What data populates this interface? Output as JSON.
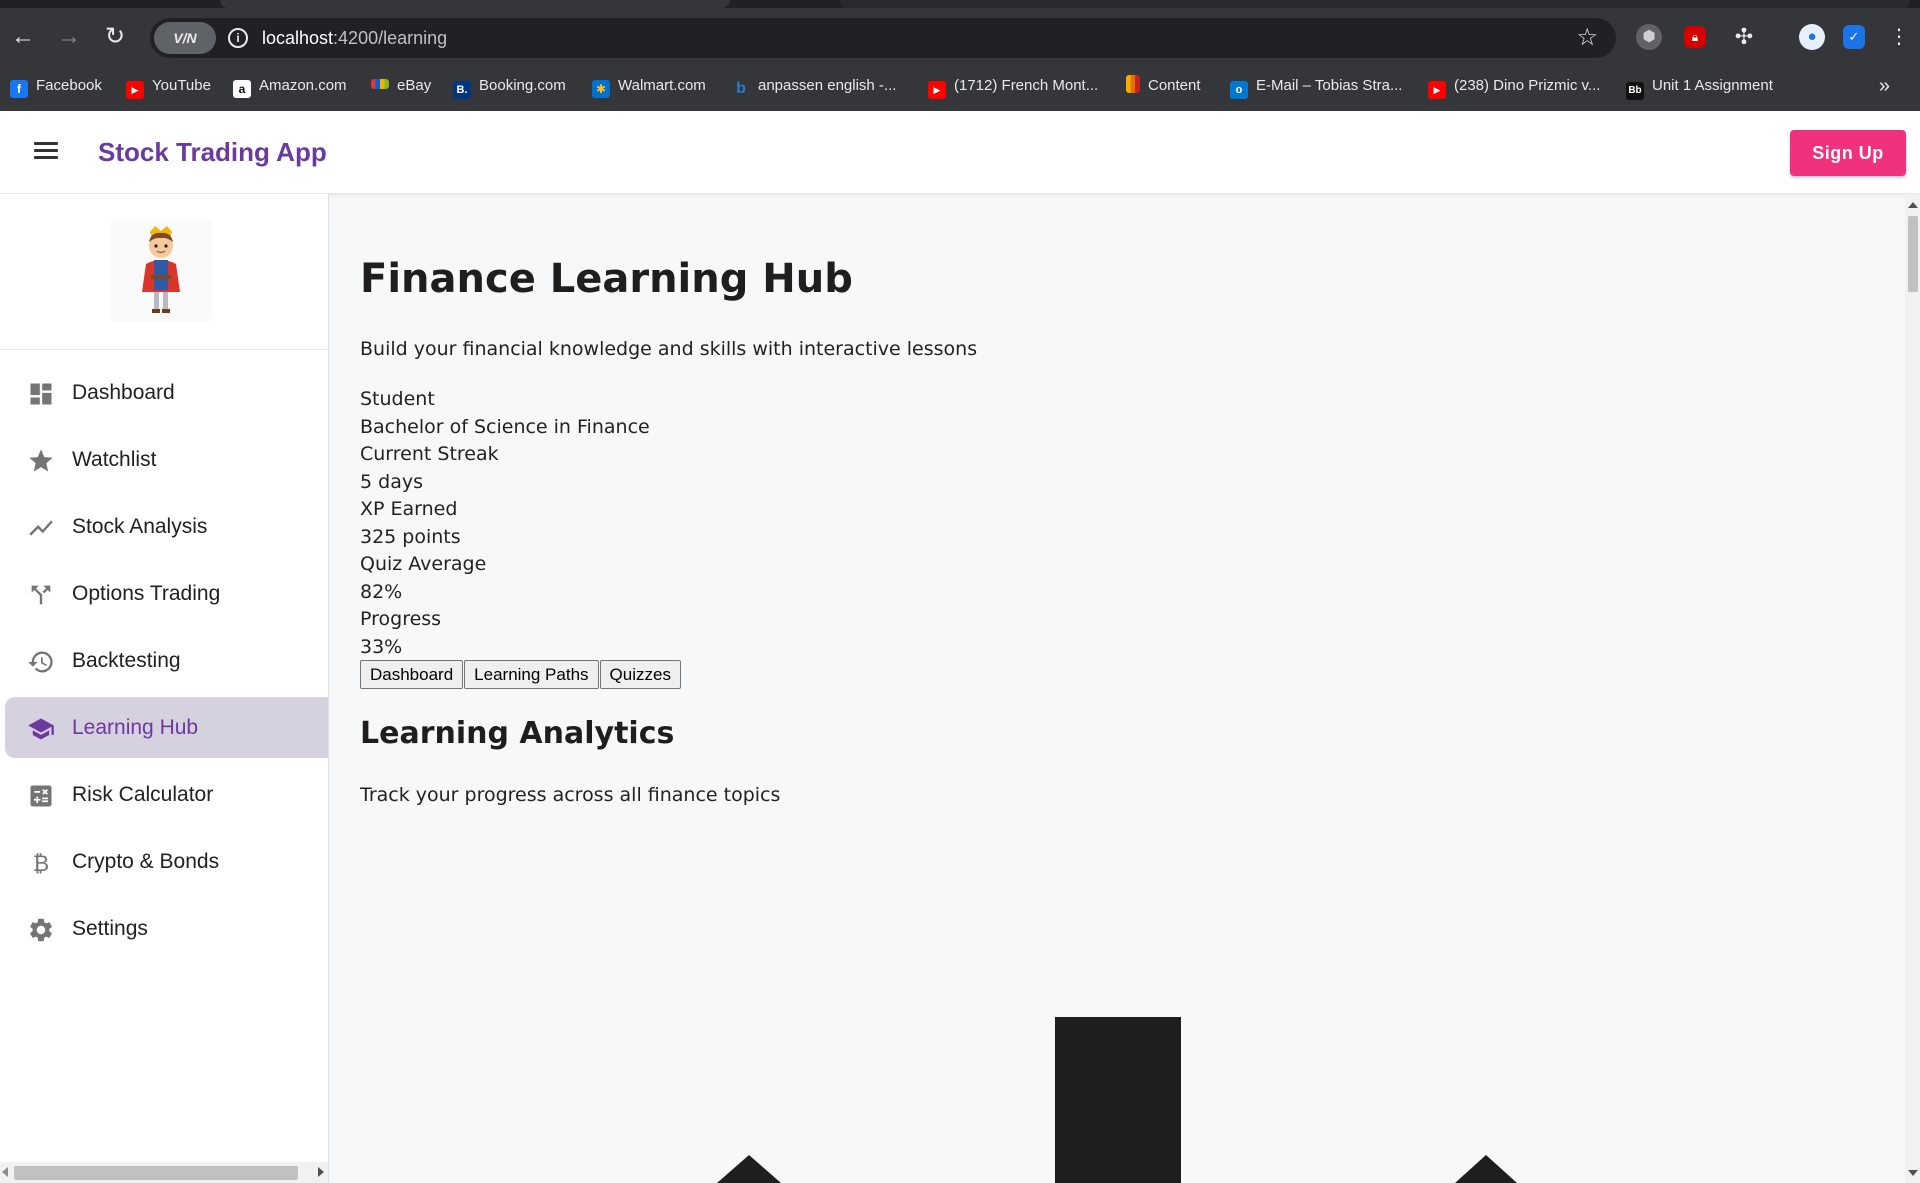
{
  "browser": {
    "url_host": "localhost",
    "url_path": ":4200/learning",
    "vpn_label": "V/N",
    "bookmarks": [
      {
        "label": "Facebook",
        "icon": "facebook-icon",
        "color": "#1877f2",
        "glyph": "f"
      },
      {
        "label": "YouTube",
        "icon": "youtube-icon",
        "color": "#ff0000",
        "glyph": "▶"
      },
      {
        "label": "Amazon.com",
        "icon": "amazon-icon",
        "color": "#ffffff",
        "glyph": "a"
      },
      {
        "label": "eBay",
        "icon": "ebay-icon",
        "color": "#e53238",
        "glyph": ""
      },
      {
        "label": "Booking.com",
        "icon": "booking-icon",
        "color": "#003580",
        "glyph": "B."
      },
      {
        "label": "Walmart.com",
        "icon": "walmart-icon",
        "color": "#0071ce",
        "glyph": "✱"
      },
      {
        "label": "anpassen english -...",
        "icon": "bing-icon",
        "color": "#2b7cd3",
        "glyph": "b"
      },
      {
        "label": "(1712) French Mont...",
        "icon": "youtube-icon",
        "color": "#ff0000",
        "glyph": "▶"
      },
      {
        "label": "Content",
        "icon": "analytics-icon",
        "color": "#f9ab00",
        "glyph": "▮"
      },
      {
        "label": "E-Mail – Tobias Stra...",
        "icon": "outlook-icon",
        "color": "#0078d4",
        "glyph": "o"
      },
      {
        "label": "(238) Dino Prizmic v...",
        "icon": "youtube-icon",
        "color": "#ff0000",
        "glyph": "▶"
      },
      {
        "label": "Unit 1 Assignment",
        "icon": "blackboard-icon",
        "color": "#111111",
        "glyph": "Bb"
      }
    ]
  },
  "header": {
    "app_title": "Stock Trading App",
    "signup_label": "Sign Up"
  },
  "sidebar": {
    "items": [
      {
        "label": "Dashboard",
        "icon": "dashboard-icon",
        "active": false
      },
      {
        "label": "Watchlist",
        "icon": "star-icon",
        "active": false
      },
      {
        "label": "Stock Analysis",
        "icon": "trending-line-icon",
        "active": false
      },
      {
        "label": "Options Trading",
        "icon": "call-split-icon",
        "active": false
      },
      {
        "label": "Backtesting",
        "icon": "history-icon",
        "active": false
      },
      {
        "label": "Learning Hub",
        "icon": "school-icon",
        "active": true
      },
      {
        "label": "Risk Calculator",
        "icon": "calculator-icon",
        "active": false
      },
      {
        "label": "Crypto & Bonds",
        "icon": "bitcoin-icon",
        "active": false
      },
      {
        "label": "Settings",
        "icon": "gear-icon",
        "active": false
      }
    ]
  },
  "main": {
    "title": "Finance Learning Hub",
    "subtitle": "Build your financial knowledge and skills with interactive lessons",
    "profile_role": "Student",
    "profile_degree": "Bachelor of Science in Finance",
    "streak_label": "Current Streak",
    "streak_value": "5 days",
    "xp_label": "XP Earned",
    "xp_value": "325 points",
    "quiz_label": "Quiz Average",
    "quiz_value": "82%",
    "progress_label": "Progress",
    "progress_value": "33%",
    "tabs": [
      "Dashboard",
      "Learning Paths",
      "Quizzes"
    ],
    "analytics_title": "Learning Analytics",
    "analytics_subtitle": "Track your progress across all finance topics"
  },
  "colors": {
    "brand_purple": "#6a3aa0",
    "signup_pink": "#f0317e",
    "active_nav_bg": "#d6d1de"
  }
}
